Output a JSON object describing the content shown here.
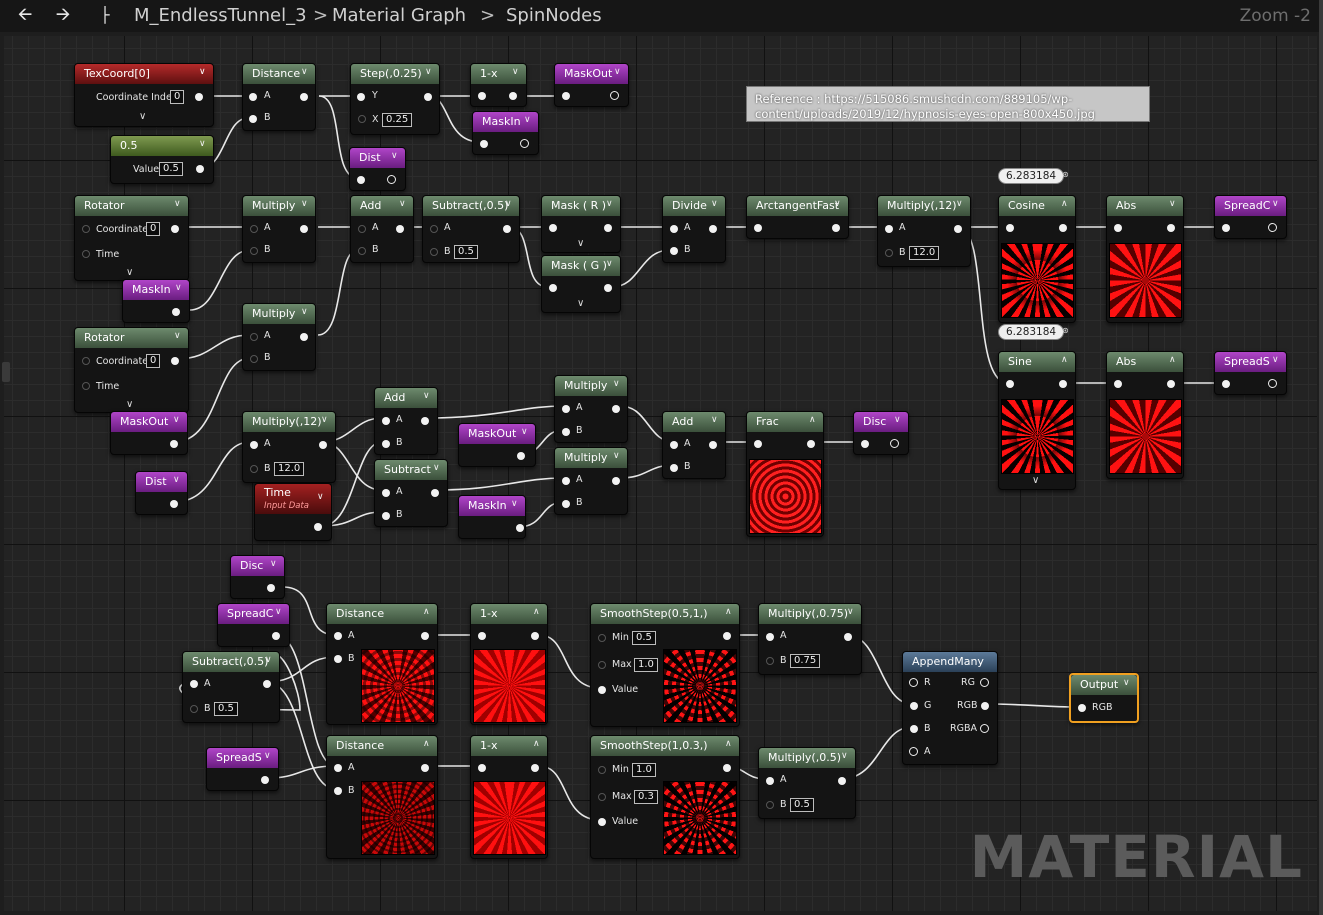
{
  "toolbar": {
    "back_icon": "arrow-left-icon",
    "forward_icon": "arrow-right-icon",
    "hierarchy_icon": "hierarchy-icon",
    "crumbs": [
      "M_EndlessTunnel_3",
      "Material Graph",
      "SpinNodes"
    ],
    "zoom": "Zoom -2"
  },
  "comment": "Reference : https://515086.smushcdn.com/889105/wp-content/uploads/2019/12/hypnosis-eyes-open-800x450.jpg",
  "watermark": "MATERIAL",
  "nodes": {
    "texcoord": {
      "title": "TexCoord[0]",
      "label": "Coordinate Index",
      "value": "0"
    },
    "const05": {
      "title": "0.5",
      "label": "Value",
      "value": "0.5"
    },
    "distance_top": {
      "title": "Distance",
      "a": "A",
      "b": "B"
    },
    "step": {
      "title": "Step(,0.25)",
      "y": "Y",
      "x": "X",
      "x_value": "0.25"
    },
    "onex_top": {
      "title": "1-x"
    },
    "maskout_top": {
      "title": "MaskOut"
    },
    "maskin_top": {
      "title": "MaskIn"
    },
    "dist_top": {
      "title": "Dist"
    },
    "rotator1": {
      "title": "Rotator",
      "coordinate": "Coordinate",
      "coord_value": "0",
      "time": "Time"
    },
    "maskin_r1": {
      "title": "MaskIn"
    },
    "multiply1": {
      "title": "Multiply",
      "a": "A",
      "b": "B"
    },
    "add1": {
      "title": "Add",
      "a": "A",
      "b": "B"
    },
    "subtract1": {
      "title": "Subtract(,0.5)",
      "a": "A",
      "b": "B",
      "b_value": "0.5"
    },
    "mask_r": {
      "title": "Mask ( R )"
    },
    "mask_g": {
      "title": "Mask ( G )"
    },
    "divide": {
      "title": "Divide",
      "a": "A",
      "b": "B"
    },
    "arctan": {
      "title": "ArctangentFast"
    },
    "multiply12_top": {
      "title": "Multiply(,12)",
      "a": "A",
      "b": "B",
      "b_value": "12.0"
    },
    "cosine": {
      "title": "Cosine",
      "bubble": "6.283184"
    },
    "abs_top": {
      "title": "Abs"
    },
    "spreadc_top": {
      "title": "SpreadC"
    },
    "sine": {
      "title": "Sine",
      "bubble": "6.283184"
    },
    "abs_bottom": {
      "title": "Abs"
    },
    "spreads_top": {
      "title": "SpreadS"
    },
    "rotator2": {
      "title": "Rotator",
      "coordinate": "Coordinate",
      "coord_value": "0",
      "time": "Time"
    },
    "multiply2": {
      "title": "Multiply",
      "a": "A",
      "b": "B"
    },
    "maskout_r2": {
      "title": "MaskOut"
    },
    "dist_mid": {
      "title": "Dist"
    },
    "multiply12_mid": {
      "title": "Multiply(,12)",
      "a": "A",
      "b": "B",
      "b_value": "12.0"
    },
    "time": {
      "title": "Time",
      "subtitle": "Input Data"
    },
    "add_mid": {
      "title": "Add",
      "a": "A",
      "b": "B"
    },
    "subtract_mid": {
      "title": "Subtract",
      "a": "A",
      "b": "B"
    },
    "maskout_mid": {
      "title": "MaskOut"
    },
    "maskin_mid": {
      "title": "MaskIn"
    },
    "multiply_mid1": {
      "title": "Multiply",
      "a": "A",
      "b": "B"
    },
    "multiply_mid2": {
      "title": "Multiply",
      "a": "A",
      "b": "B"
    },
    "add_mid2": {
      "title": "Add",
      "a": "A",
      "b": "B"
    },
    "frac": {
      "title": "Frac"
    },
    "disc_mid": {
      "title": "Disc"
    },
    "disc_bot": {
      "title": "Disc"
    },
    "spreadc_bot": {
      "title": "SpreadC"
    },
    "subtract_bot": {
      "title": "Subtract(,0.5)",
      "a": "A",
      "b": "B",
      "b_value": "0.5"
    },
    "spreads_bot": {
      "title": "SpreadS"
    },
    "distance_b1": {
      "title": "Distance",
      "a": "A",
      "b": "B"
    },
    "distance_b2": {
      "title": "Distance",
      "a": "A",
      "b": "B"
    },
    "onex_b1": {
      "title": "1-x"
    },
    "onex_b2": {
      "title": "1-x"
    },
    "smooth1": {
      "title": "SmoothStep(0.5,1,)",
      "min": "Min",
      "min_value": "0.5",
      "max": "Max",
      "max_value": "1.0",
      "value": "Value"
    },
    "smooth2": {
      "title": "SmoothStep(1,0.3,)",
      "min": "Min",
      "min_value": "1.0",
      "max": "Max",
      "max_value": "0.3",
      "value": "Value"
    },
    "multiply075": {
      "title": "Multiply(,0.75)",
      "a": "A",
      "b": "B",
      "b_value": "0.75"
    },
    "multiply05": {
      "title": "Multiply(,0.5)",
      "a": "A",
      "b": "B",
      "b_value": "0.5"
    },
    "appendmany": {
      "title": "AppendMany",
      "r": "R",
      "g": "G",
      "b": "B",
      "a": "A",
      "rg": "RG",
      "rgb": "RGB",
      "rgba": "RGBA"
    },
    "output": {
      "title": "Output",
      "rgb": "RGB"
    }
  }
}
